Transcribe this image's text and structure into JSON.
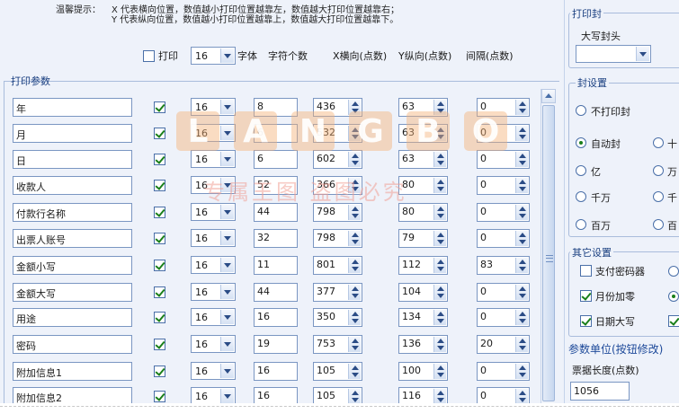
{
  "tips": {
    "title": "温馨提示：",
    "x_line": "X 代表横向位置，数值越小打印位置越靠左，数值越大打印位置越靠右；",
    "y_line": "Y 代表纵向位置，数值越小打印位置越靠上，数值越大打印位置越靠下。"
  },
  "header": {
    "print_label": "打印",
    "font_size_value": "16",
    "font_label": "字体",
    "char_count_label": "字符个数",
    "x_label": "X横向(点数)",
    "y_label": "Y纵向(点数)",
    "spacing_label": "间隔(点数)"
  },
  "params_caption": "打印参数",
  "rows": [
    {
      "name": "年",
      "checked": true,
      "font": "16",
      "chars": "8",
      "x": "436",
      "y": "63",
      "gap": "0"
    },
    {
      "name": "月",
      "checked": true,
      "font": "16",
      "chars": "6",
      "x": "532",
      "y": "63",
      "gap": "0"
    },
    {
      "name": "日",
      "checked": true,
      "font": "16",
      "chars": "6",
      "x": "602",
      "y": "63",
      "gap": "0"
    },
    {
      "name": "收款人",
      "checked": true,
      "font": "16",
      "chars": "52",
      "x": "366",
      "y": "80",
      "gap": "0"
    },
    {
      "name": "付款行名称",
      "checked": true,
      "font": "16",
      "chars": "44",
      "x": "798",
      "y": "80",
      "gap": "0"
    },
    {
      "name": "出票人账号",
      "checked": true,
      "font": "16",
      "chars": "32",
      "x": "798",
      "y": "79",
      "gap": "0"
    },
    {
      "name": "金额小写",
      "checked": true,
      "font": "16",
      "chars": "11",
      "x": "801",
      "y": "112",
      "gap": "83"
    },
    {
      "name": "金额大写",
      "checked": true,
      "font": "16",
      "chars": "44",
      "x": "377",
      "y": "104",
      "gap": "0"
    },
    {
      "name": "用途",
      "checked": true,
      "font": "16",
      "chars": "16",
      "x": "350",
      "y": "134",
      "gap": "0"
    },
    {
      "name": "密码",
      "checked": true,
      "font": "16",
      "chars": "19",
      "x": "753",
      "y": "136",
      "gap": "20"
    },
    {
      "name": "附加信息1",
      "checked": true,
      "font": "16",
      "chars": "16",
      "x": "105",
      "y": "100",
      "gap": "0"
    },
    {
      "name": "附加信息2",
      "checked": true,
      "font": "16",
      "chars": "16",
      "x": "105",
      "y": "116",
      "gap": "0"
    }
  ],
  "right_panel": {
    "print_seal_caption": "打印封",
    "uppercase_label": "大写封头",
    "seal_settings_caption": "封设置",
    "no_print_seal": "不打印封",
    "auto_seal": "自动封",
    "ten_partial": "十",
    "yi": "亿",
    "wan_partial": "万",
    "qianwan": "千万",
    "qian_partial": "千",
    "baiwan": "百万",
    "bai_partial": "百",
    "other_caption": "其它设置",
    "pay_code_device": "支付密码器",
    "month_pad_zero": "月份加零",
    "day_uppercase": "日期大写",
    "unit_title": "参数单位(按钮修改)",
    "ticket_length_label": "票据长度(点数)",
    "ticket_length_value": "1056"
  },
  "watermark": {
    "letters": [
      "L",
      "A",
      "N",
      "G",
      "B",
      "O"
    ],
    "slogan": "专属王图 盗图必究"
  },
  "colors": {
    "panel_bg": "#eef2fa",
    "caption_blue": "#1a3f80",
    "border_blue": "#7a96c2",
    "check_green": "#1a7f1a",
    "unit_title": "#1e4a9a"
  }
}
